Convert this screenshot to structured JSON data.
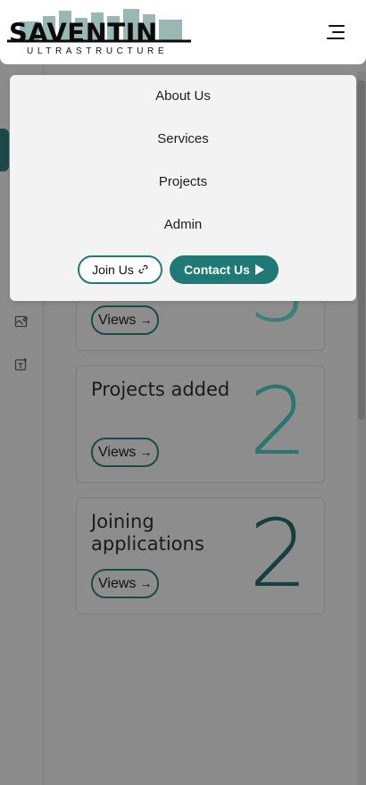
{
  "header": {
    "logo_text": "SAVENTIN",
    "logo_subtitle": "ULTRASTRUCTURE",
    "menu_icon": "hamburger-icon"
  },
  "menu": {
    "items": [
      {
        "label": "About Us"
      },
      {
        "label": "Services"
      },
      {
        "label": "Projects"
      },
      {
        "label": "Admin"
      }
    ],
    "join_label": "Join Us",
    "join_icon": "link-icon",
    "contact_label": "Contact Us",
    "contact_icon": "play-icon"
  },
  "sidebar": {
    "icons": [
      "image-edit-icon",
      "add-text-icon"
    ]
  },
  "cards": [
    {
      "title": "",
      "count": "3",
      "views_label": "Views"
    },
    {
      "title": "Projects added",
      "count": "2",
      "views_label": "Views"
    },
    {
      "title": "Joining applications",
      "count": "2",
      "views_label": "Views"
    }
  ],
  "colors": {
    "accent": "#1f7a76",
    "dark_accent": "#1c4a48",
    "overlay_bg": "#8c8c8c",
    "menu_bg": "#f3f3f3"
  }
}
